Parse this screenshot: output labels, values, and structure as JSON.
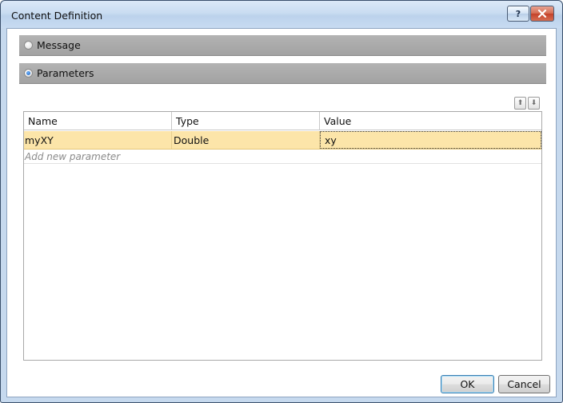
{
  "window": {
    "title": "Content Definition",
    "help_glyph": "?",
    "close_glyph": "✕"
  },
  "groups": {
    "message_label": "Message",
    "message_checked": false,
    "parameters_label": "Parameters",
    "parameters_checked": true
  },
  "toolbar": {
    "move_up_glyph": "⬆",
    "move_down_glyph": "⬇"
  },
  "grid": {
    "columns": [
      "Name",
      "Type",
      "Value"
    ],
    "rows": [
      {
        "name": "myXY",
        "type": "Double",
        "value": "xy"
      }
    ],
    "add_placeholder": "Add new parameter"
  },
  "buttons": {
    "ok": "OK",
    "cancel": "Cancel"
  },
  "colors": {
    "selected_row": "#fce5a9",
    "group_header": "#a9a9a9",
    "window_frame": "#c6d9ee"
  }
}
